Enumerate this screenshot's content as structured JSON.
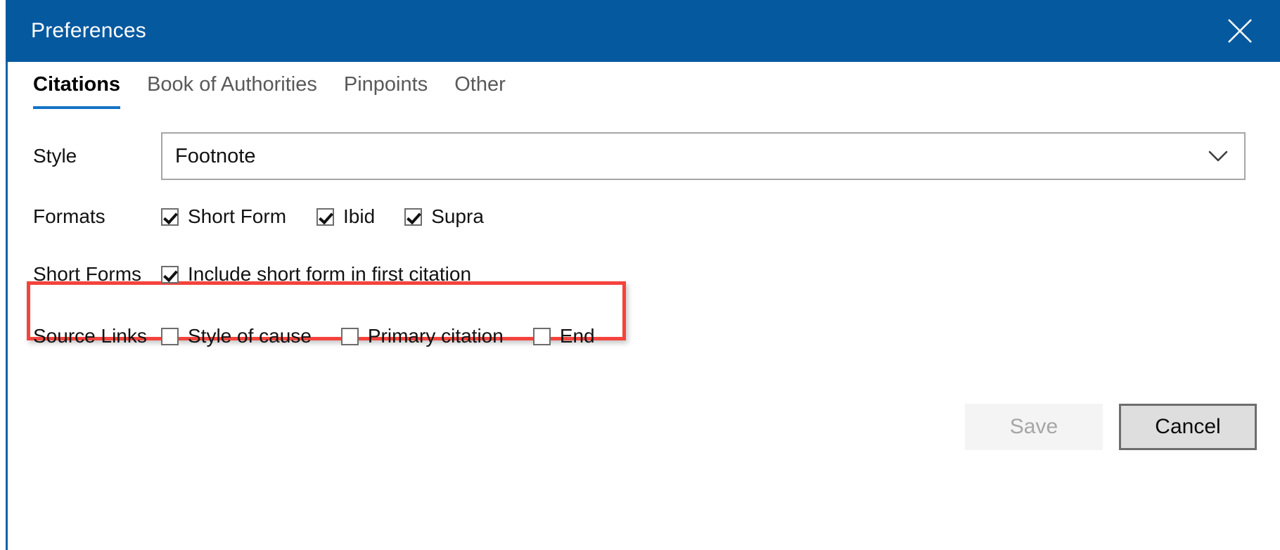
{
  "window": {
    "title": "Preferences",
    "close_icon": "close-icon",
    "accent_color": "#05599f",
    "tab_underline_color": "#1573c6",
    "annotation_color": "#f4433c"
  },
  "tabs": [
    {
      "label": "Citations",
      "active": true
    },
    {
      "label": "Book of Authorities",
      "active": false
    },
    {
      "label": "Pinpoints",
      "active": false
    },
    {
      "label": "Other",
      "active": false
    }
  ],
  "rows": {
    "style": {
      "label": "Style",
      "value": "Footnote",
      "chevron_icon": "chevron-down-icon"
    },
    "formats": {
      "label": "Formats",
      "highlighted": true,
      "options": [
        {
          "label": "Short Form",
          "checked": true
        },
        {
          "label": "Ibid",
          "checked": true
        },
        {
          "label": "Supra",
          "checked": true
        }
      ]
    },
    "short_forms": {
      "label": "Short Forms",
      "options": [
        {
          "label": "Include short form in first citation",
          "checked": true
        }
      ]
    },
    "source_links": {
      "label": "Source Links",
      "options": [
        {
          "label": "Style of cause",
          "checked": false
        },
        {
          "label": "Primary citation",
          "checked": false
        },
        {
          "label": "End",
          "checked": false
        }
      ]
    }
  },
  "footer": {
    "save_label": "Save",
    "save_disabled": true,
    "cancel_label": "Cancel"
  }
}
